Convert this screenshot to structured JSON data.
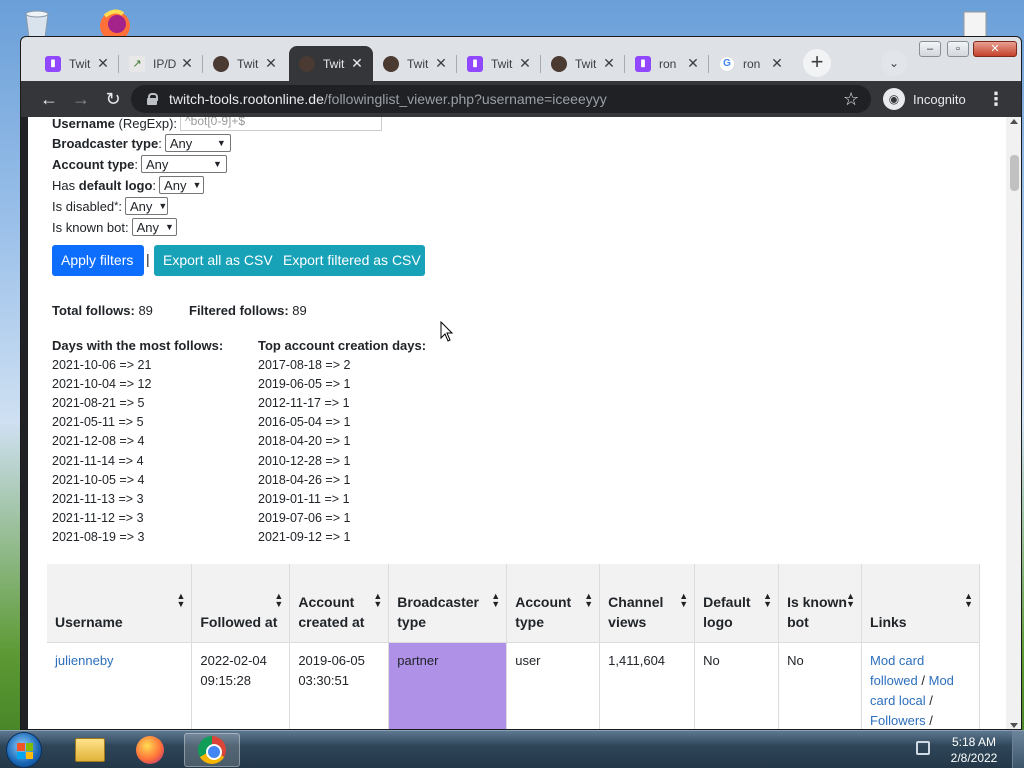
{
  "browser": {
    "tabs": [
      {
        "title": "Twit",
        "favicon": "twitch-icon"
      },
      {
        "title": "IP/D",
        "favicon": "ip-icon"
      },
      {
        "title": "Twit",
        "favicon": "avatar-icon"
      },
      {
        "title": "Twit",
        "favicon": "avatar-icon",
        "active": true
      },
      {
        "title": "Twit",
        "favicon": "avatar-icon"
      },
      {
        "title": "Twit",
        "favicon": "twitch-icon"
      },
      {
        "title": "Twit",
        "favicon": "avatar-icon"
      },
      {
        "title": "ron",
        "favicon": "twitch-icon"
      },
      {
        "title": "ron",
        "favicon": "google-icon"
      }
    ],
    "url_host": "twitch-tools.rootonline.de",
    "url_path": "/followinglist_viewer.php?username=iceeeyyy",
    "incognito_label": "Incognito"
  },
  "filters": {
    "username_label": "Username",
    "username_hint": "(RegExp):",
    "username_placeholder": "^bot[0-9]+$",
    "broadcaster_type_label": "Broadcaster type",
    "account_type_label": "Account type",
    "default_logo_prefix": "Has",
    "default_logo_label": "default logo",
    "disabled_label": "Is disabled",
    "disabled_note": "*",
    "known_bot_label": "Is known bot:",
    "select_value": "Any",
    "apply_button": "Apply filters",
    "separator": "|",
    "export_all_button": "Export all as CSV",
    "export_filtered_button": "Export filtered as CSV"
  },
  "totals": {
    "total_label": "Total follows:",
    "total_value": "89",
    "filtered_label": "Filtered follows:",
    "filtered_value": "89"
  },
  "stats": {
    "days_title": "Days with the most follows:",
    "days": [
      {
        "date": "2021-10-06 =>",
        "count": "21"
      },
      {
        "date": "2021-10-04 =>",
        "count": "12"
      },
      {
        "date": "2021-08-21 =>",
        "count": "5"
      },
      {
        "date": "2021-05-11 =>",
        "count": "5"
      },
      {
        "date": "2021-12-08 =>",
        "count": "4"
      },
      {
        "date": "2021-11-14 =>",
        "count": "4"
      },
      {
        "date": "2021-10-05 =>",
        "count": "4"
      },
      {
        "date": "2021-11-13 =>",
        "count": "3"
      },
      {
        "date": "2021-11-12 =>",
        "count": "3"
      },
      {
        "date": "2021-08-19 =>",
        "count": "3"
      }
    ],
    "creation_title": "Top account creation days:",
    "creation": [
      {
        "date": "2017-08-18 =>",
        "count": "2"
      },
      {
        "date": "2019-06-05 =>",
        "count": "1"
      },
      {
        "date": "2012-11-17 =>",
        "count": "1"
      },
      {
        "date": "2016-05-04 =>",
        "count": "1"
      },
      {
        "date": "2018-04-20 =>",
        "count": "1"
      },
      {
        "date": "2010-12-28 =>",
        "count": "1"
      },
      {
        "date": "2018-04-26 =>",
        "count": "1"
      },
      {
        "date": "2019-01-11 =>",
        "count": "1"
      },
      {
        "date": "2019-07-06 =>",
        "count": "1"
      },
      {
        "date": "2021-09-12 =>",
        "count": "1"
      }
    ]
  },
  "table": {
    "headers": [
      "Username",
      "Followed at",
      "Account created at",
      "Broadcaster type",
      "Account type",
      "Channel views",
      "Default logo",
      "Is known bot",
      "Links"
    ],
    "rows": [
      {
        "username": "julienneby",
        "followed_at": "2022-02-04 09:15:28",
        "created_at": "2019-06-05 03:30:51",
        "broadcaster_type": "partner",
        "account_type": "user",
        "channel_views": "1,411,604",
        "default_logo": "No",
        "known_bot": "No",
        "link_mod_followed": "Mod card followed",
        "link_sep1": "/",
        "link_mod_local": "Mod card local",
        "link_sep2": "/",
        "link_followers": "Followers",
        "link_sep3": "/"
      }
    ]
  },
  "taskbar": {
    "time": "5:18 AM",
    "date": "2/8/2022"
  },
  "colors": {
    "primary_button": "#0d6efd",
    "info_button": "#17a2b8",
    "partner_highlight": "#b091e8",
    "link": "#2d6fbd"
  }
}
